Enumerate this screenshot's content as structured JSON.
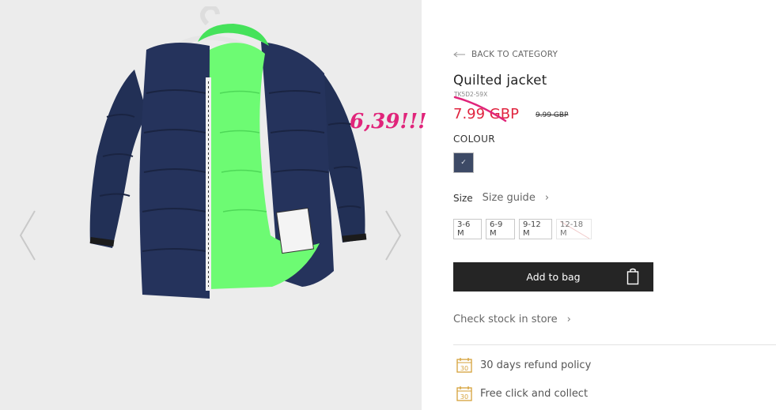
{
  "product": {
    "back_link": "BACK TO CATEGORY",
    "title": "Quilted jacket",
    "sku": "TK5D2-59X",
    "price": "7.99 GBP",
    "old_price": "9.99 GBP",
    "annotation": "6,39!!!",
    "colour_label": "COLOUR",
    "selected_colour": "#3d4a66",
    "size_label": "Size",
    "size_guide": "Size guide",
    "sizes": [
      "3-6 M",
      "6-9 M",
      "9-12 M",
      "12-18 M"
    ],
    "unavailable_size": "12-18 M",
    "add_to_bag": "Add to bag",
    "check_stock": "Check stock in store",
    "perks": [
      {
        "calendar_number": "30",
        "text": "30 days refund policy"
      },
      {
        "calendar_number": "30",
        "text": "Free click and collect"
      }
    ]
  },
  "colors": {
    "price_red": "#e0243f",
    "annotation_pink": "#e0247a",
    "button_dark": "#252525",
    "icon_gold": "#d6a23a"
  },
  "icons": [
    "arrow-left-icon",
    "check-icon",
    "chevron-right-icon",
    "shopping-bag-icon",
    "calendar-icon",
    "carousel-prev-icon",
    "carousel-next-icon"
  ]
}
